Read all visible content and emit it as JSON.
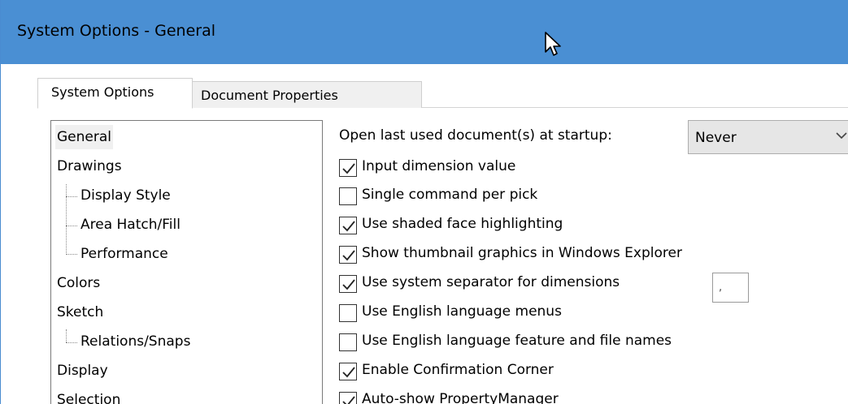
{
  "window": {
    "title": "System Options - General"
  },
  "tabs": [
    {
      "label": "System Options",
      "active": true
    },
    {
      "label": "Document Properties",
      "active": false
    }
  ],
  "tree": {
    "items": [
      {
        "label": "General",
        "level": 0,
        "selected": true
      },
      {
        "label": "Drawings",
        "level": 0
      },
      {
        "label": "Display Style",
        "level": 1
      },
      {
        "label": "Area Hatch/Fill",
        "level": 1
      },
      {
        "label": "Performance",
        "level": 1
      },
      {
        "label": "Colors",
        "level": 0
      },
      {
        "label": "Sketch",
        "level": 0
      },
      {
        "label": "Relations/Snaps",
        "level": 1
      },
      {
        "label": "Display",
        "level": 0
      },
      {
        "label": "Selection",
        "level": 0
      }
    ]
  },
  "options": {
    "startup_label": "Open last used document(s) at startup:",
    "startup_value": "Never",
    "checkboxes": [
      {
        "label": "Input dimension value",
        "checked": true
      },
      {
        "label": "Single command per pick",
        "checked": false
      },
      {
        "label": "Use shaded face highlighting",
        "checked": true
      },
      {
        "label": "Show thumbnail graphics in Windows Explorer",
        "checked": true
      },
      {
        "label": "Use system separator for dimensions",
        "checked": true
      },
      {
        "label": "Use English language menus",
        "checked": false
      },
      {
        "label": "Use English language feature and file names",
        "checked": false
      },
      {
        "label": "Enable Confirmation Corner",
        "checked": true
      },
      {
        "label": "Auto-show PropertyManager",
        "checked": true
      }
    ],
    "separator_value": ","
  },
  "colors": {
    "titlebar": "#4a8fd3",
    "selected_tree_bg": "#f0f0f0"
  },
  "icons": {
    "cursor": "mouse-pointer-icon",
    "combo_arrow": "chevron-down-icon",
    "check": "checkmark-icon"
  }
}
